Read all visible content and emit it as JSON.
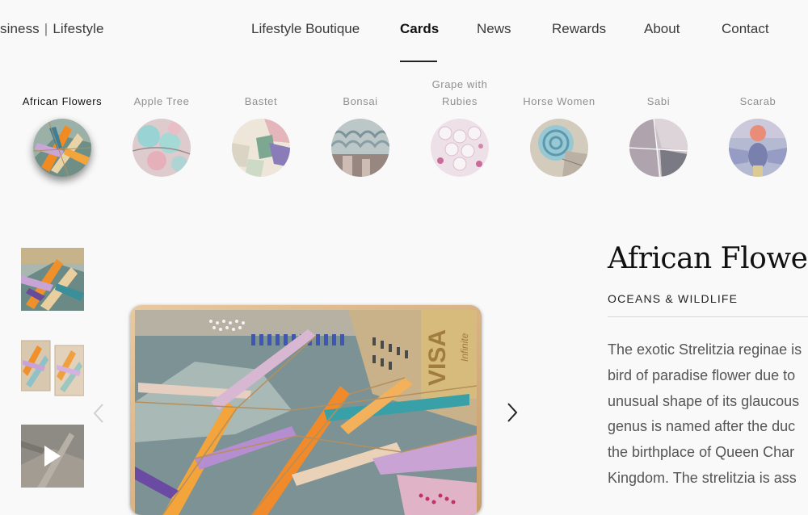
{
  "header": {
    "brand_left": "siness",
    "brand_sep": "|",
    "brand_right": "Lifestyle",
    "nav": [
      {
        "label": "Lifestyle Boutique"
      },
      {
        "label": "Cards",
        "active": true
      },
      {
        "label": "News"
      },
      {
        "label": "Rewards"
      },
      {
        "label": "About"
      },
      {
        "label": "Contact"
      }
    ]
  },
  "designs": [
    {
      "label": "African Flowers",
      "active": true
    },
    {
      "label": "Apple Tree"
    },
    {
      "label": "Bastet"
    },
    {
      "label": "Bonsai"
    },
    {
      "label": "Grape with Rubies"
    },
    {
      "label": "Horse Women"
    },
    {
      "label": "Sabi"
    },
    {
      "label": "Scarab"
    }
  ],
  "card": {
    "brand": "VISA",
    "tier": "Infinite"
  },
  "product": {
    "title": "African Flowers",
    "category": "OCEANS & WILDLIFE",
    "description_lines": [
      "The exotic Strelitzia reginae is",
      "bird of paradise flower due to",
      "unusual shape of its glaucous",
      "genus is named after the duc",
      "the birthplace of Queen Char",
      "Kingdom. The strelitzia is ass"
    ]
  },
  "colors": {
    "active_text": "#111111",
    "inactive_label": "#8f8f8f",
    "divider": "#d8d8d8"
  }
}
